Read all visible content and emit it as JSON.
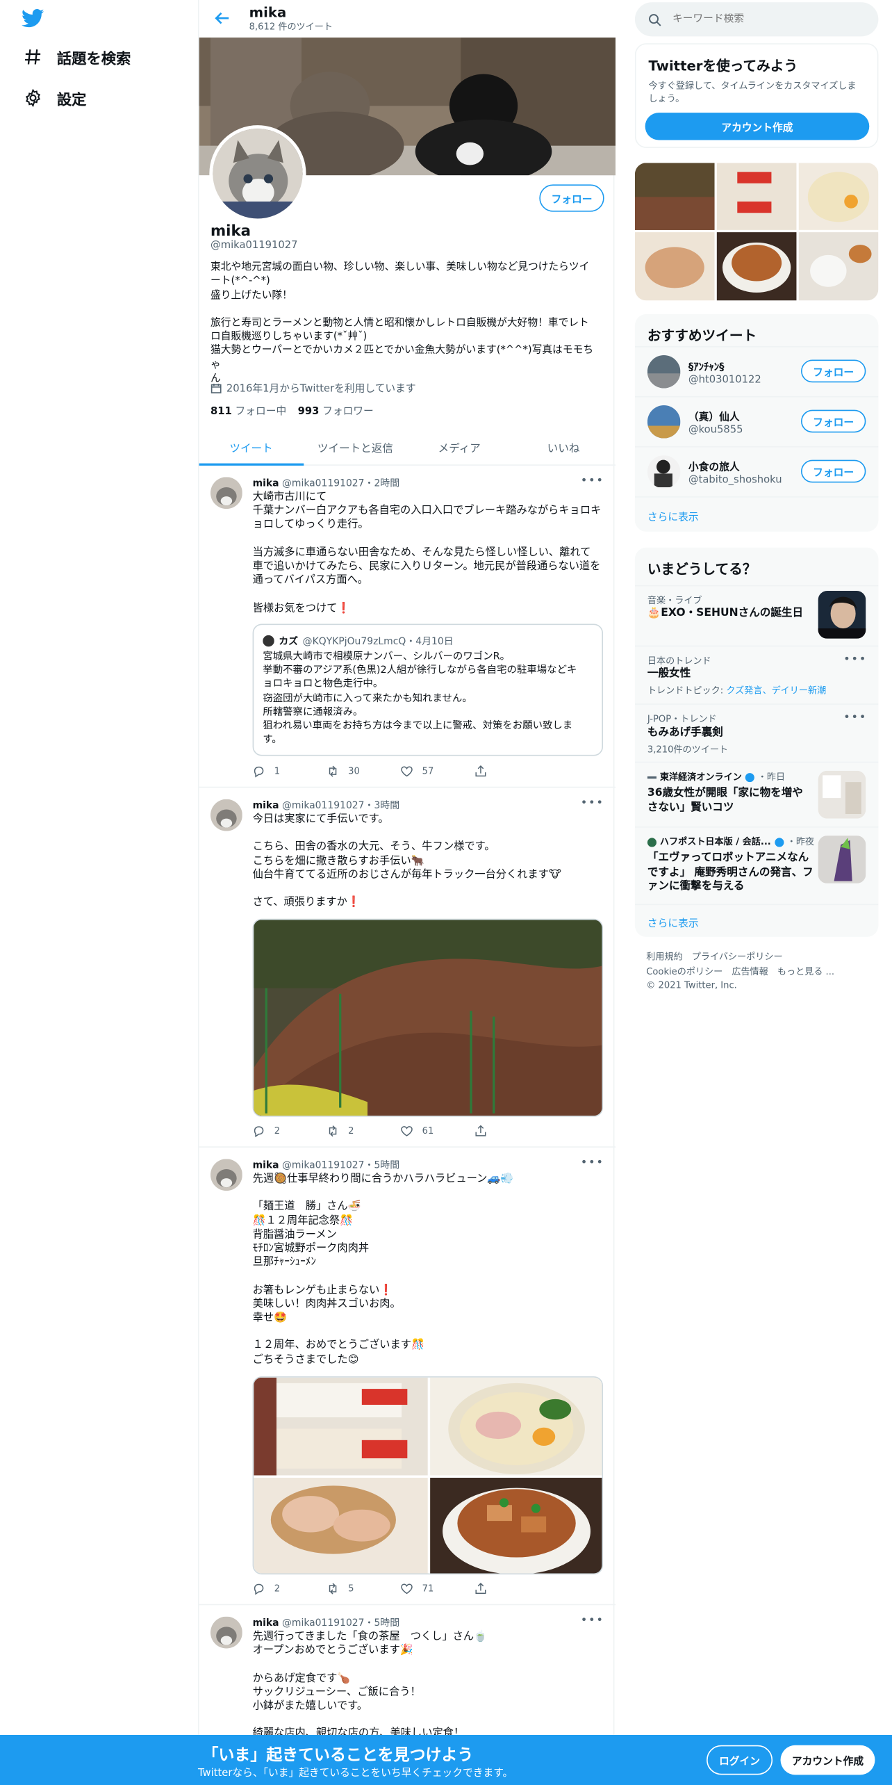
{
  "colors": {
    "accent": "#1d9bf0",
    "text": "#0f1419",
    "muted": "#536471"
  },
  "nav": {
    "items": [
      {
        "label": "話題を検索",
        "icon": "hash-icon"
      },
      {
        "label": "設定",
        "icon": "gear-icon"
      }
    ]
  },
  "header": {
    "title": "mika",
    "subtitle": "8,612 件のツイート"
  },
  "profile": {
    "follow_label": "フォロー",
    "name": "mika",
    "handle": "@mika01191027",
    "bio": [
      "東北や地元宮城の面白い物、珍しい物、楽しい事、美味しい物など見つけたらツイ",
      "ート(*^-^*)",
      "盛り上げたい隊！",
      "",
      "旅行と寿司とラーメンと動物と人情と昭和懐かしレトロ自販機が大好物！車でレト",
      "ロ自販機巡りしちゃいます(*ˇ艸ˇ)",
      "猫大勢とウーパーとでかいカメ２匹とでかい金魚大勢がいます(*^^*)写真はモモちゃ",
      "ん"
    ],
    "joined": "2016年1月からTwitterを利用しています",
    "following_count": "811",
    "following_label": "フォロー中",
    "followers_count": "993",
    "followers_label": "フォロワー"
  },
  "tabs": [
    "ツイート",
    "ツイートと返信",
    "メディア",
    "いいね"
  ],
  "tweets": [
    {
      "name": "mika",
      "meta": "@mika01191027・2時間",
      "lines": [
        "大崎市古川にて",
        "千葉ナンバー白アクアも各自宅の入口入口でブレーキ踏みながらキョロキ",
        "ョロしてゆっくり走行。",
        "",
        "当方滅多に車通らない田舎なため、そんな見たら怪しい怪しい、離れて",
        "車で追いかけてみたら、民家に入りＵターン。地元民が普段通らない道を",
        "通ってバイパス方面へ。",
        "",
        "皆様お気をつけて❗"
      ],
      "quote": {
        "name": "カズ",
        "meta": "@KQYKPjOu79zLmcQ・4月10日",
        "lines": [
          "宮城県大崎市で相模原ナンバー、シルバーのワゴンR。",
          "挙動不審のアジア系(色黒)2人組が徐行しながら各自宅の駐車場などキ",
          "ョロキョロと物色走行中。",
          "窃盗団が大崎市に入って来たかも知れません。",
          "所轄警察に通報済み。",
          "狙われ易い車両をお持ち方は今まで以上に警戒、対策をお願い致しま",
          "す。"
        ]
      },
      "replies": "1",
      "retweets": "30",
      "likes": "57"
    },
    {
      "name": "mika",
      "meta": "@mika01191027・3時間",
      "lines": [
        "今日は実家にて手伝いです。",
        "",
        "こちら、田舎の香水の大元、そう、牛フン様です。",
        "こちらを畑に撒き散らすお手伝い🐂",
        "仙台牛育ててる近所のおじさんが毎年トラック一台分くれます🐮",
        "",
        "さて、頑張りますか❗"
      ],
      "replies": "2",
      "retweets": "2",
      "likes": "61"
    },
    {
      "name": "mika",
      "meta": "@mika01191027・5時間",
      "lines": [
        "先週🥘仕事早終わり間に合うかハラハラビューン🚙💨",
        "",
        "「麺王道　勝」さん🍜",
        "🎊１２周年記念祭🎊",
        "背脂醤油ラーメン",
        "ﾓﾁﾛﾝ宮城野ポーク肉肉丼",
        "旦那ﾁｬｰｼｭｰﾒﾝ",
        "",
        "お箸もレンゲも止まらない❗",
        "美味しい！肉肉丼スゴいお肉。",
        "幸せ🤩",
        "",
        "１２周年、おめでとうございます🎊",
        "ごちそうさまでした😊"
      ],
      "replies": "2",
      "retweets": "5",
      "likes": "71"
    },
    {
      "name": "mika",
      "meta": "@mika01191027・5時間",
      "lines": [
        "先週行ってきました「食の茶屋　つくし」さん🍵",
        "オープンおめでとうございます🎉",
        "",
        "からあげ定食です🍗",
        "サックリジューシー、ご飯に合う！",
        "小鉢がまた嬉しいです。",
        "",
        "綺麗な店内、親切な店の方、美味しい定食！"
      ]
    }
  ],
  "search": {
    "placeholder": "キーワード検索"
  },
  "signup": {
    "title": "Twitterを使ってみよう",
    "desc": "今すぐ登録して、タイムラインをカスタマイズしましょう。",
    "button": "アカウント作成"
  },
  "recommended": {
    "title": "おすすめツイート",
    "accounts": [
      {
        "name": "§ｱﾝﾁｬﾝ§",
        "handle": "@ht03010122"
      },
      {
        "name": "（真）仙人",
        "handle": "@kou5855"
      },
      {
        "name": "小食の旅人",
        "handle": "@tabito_shoshoku"
      }
    ],
    "follow_label": "フォロー",
    "show_more": "さらに表示"
  },
  "trends": {
    "title": "いまどうしてる？",
    "items": [
      {
        "category": "音楽・ライブ",
        "title": "🎂EXO・SEHUNさんの誕生日"
      },
      {
        "category": "日本のトレンド",
        "title": "一般女性",
        "meta_prefix": "トレンドトピック: ",
        "meta_links": "クズ発言、デイリー新潮"
      },
      {
        "category": "J-POP・トレンド",
        "title": "もみあげ手裏剣",
        "meta": "3,210件のツイート"
      },
      {
        "category": "東洋経済オンライン",
        "time": "・昨日",
        "title": "36歳女性が開眼「家に物を増やさない」賢いコツ"
      },
      {
        "category": "ハフポスト日本版 / 会話...",
        "time": "・昨夜",
        "title": "「エヴァってロボットアニメなんですよ」 庵野秀明さんの発言、ファンに衝撃を与える"
      }
    ],
    "show_more": "さらに表示"
  },
  "footer": {
    "links1": "利用規約　プライバシーポリシー",
    "links2": "Cookieのポリシー　広告情報　もっと見る ...",
    "copyright": "© 2021 Twitter, Inc."
  },
  "bottom": {
    "title": "「いま」起きていることを見つけよう",
    "subtitle": "Twitterなら、「いま」起きていることをいち早くチェックできます。",
    "login": "ログイン",
    "signup": "アカウント作成"
  }
}
